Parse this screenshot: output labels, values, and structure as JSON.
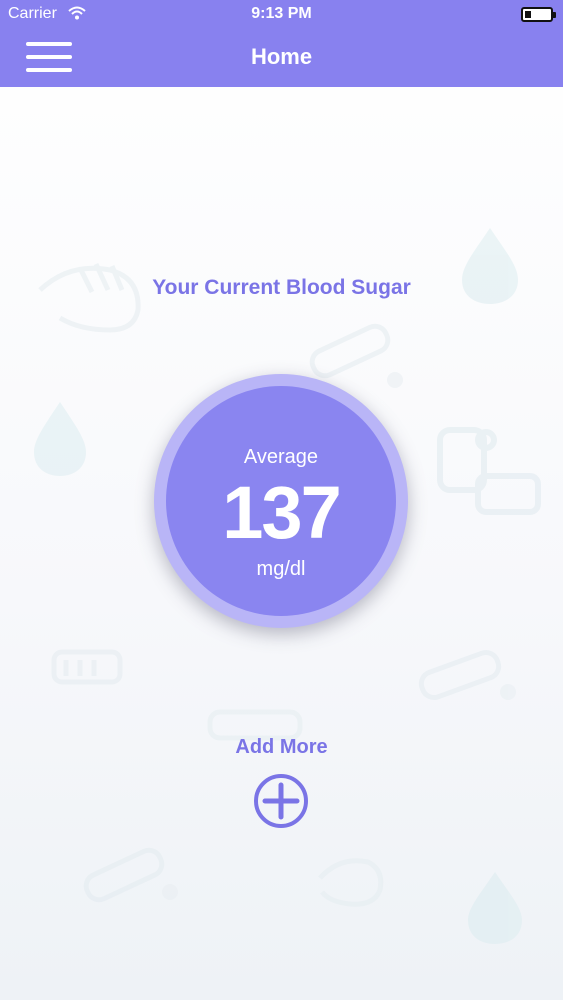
{
  "status_bar": {
    "carrier": "Carrier",
    "time": "9:13 PM",
    "wifi_icon": "wifi-icon",
    "battery_icon": "battery-icon"
  },
  "nav": {
    "title": "Home",
    "menu_icon": "hamburger-menu-icon"
  },
  "main": {
    "heading": "Your Current Blood Sugar",
    "reading": {
      "label": "Average",
      "value": "137",
      "unit": "mg/dl"
    },
    "add_more": {
      "label": "Add More",
      "icon": "plus-circle-icon"
    }
  },
  "colors": {
    "primary": "#8881ef",
    "accent_text": "#7a74e6",
    "circle_ring": "#b9b5f7",
    "circle_fill": "#8a85f0"
  }
}
